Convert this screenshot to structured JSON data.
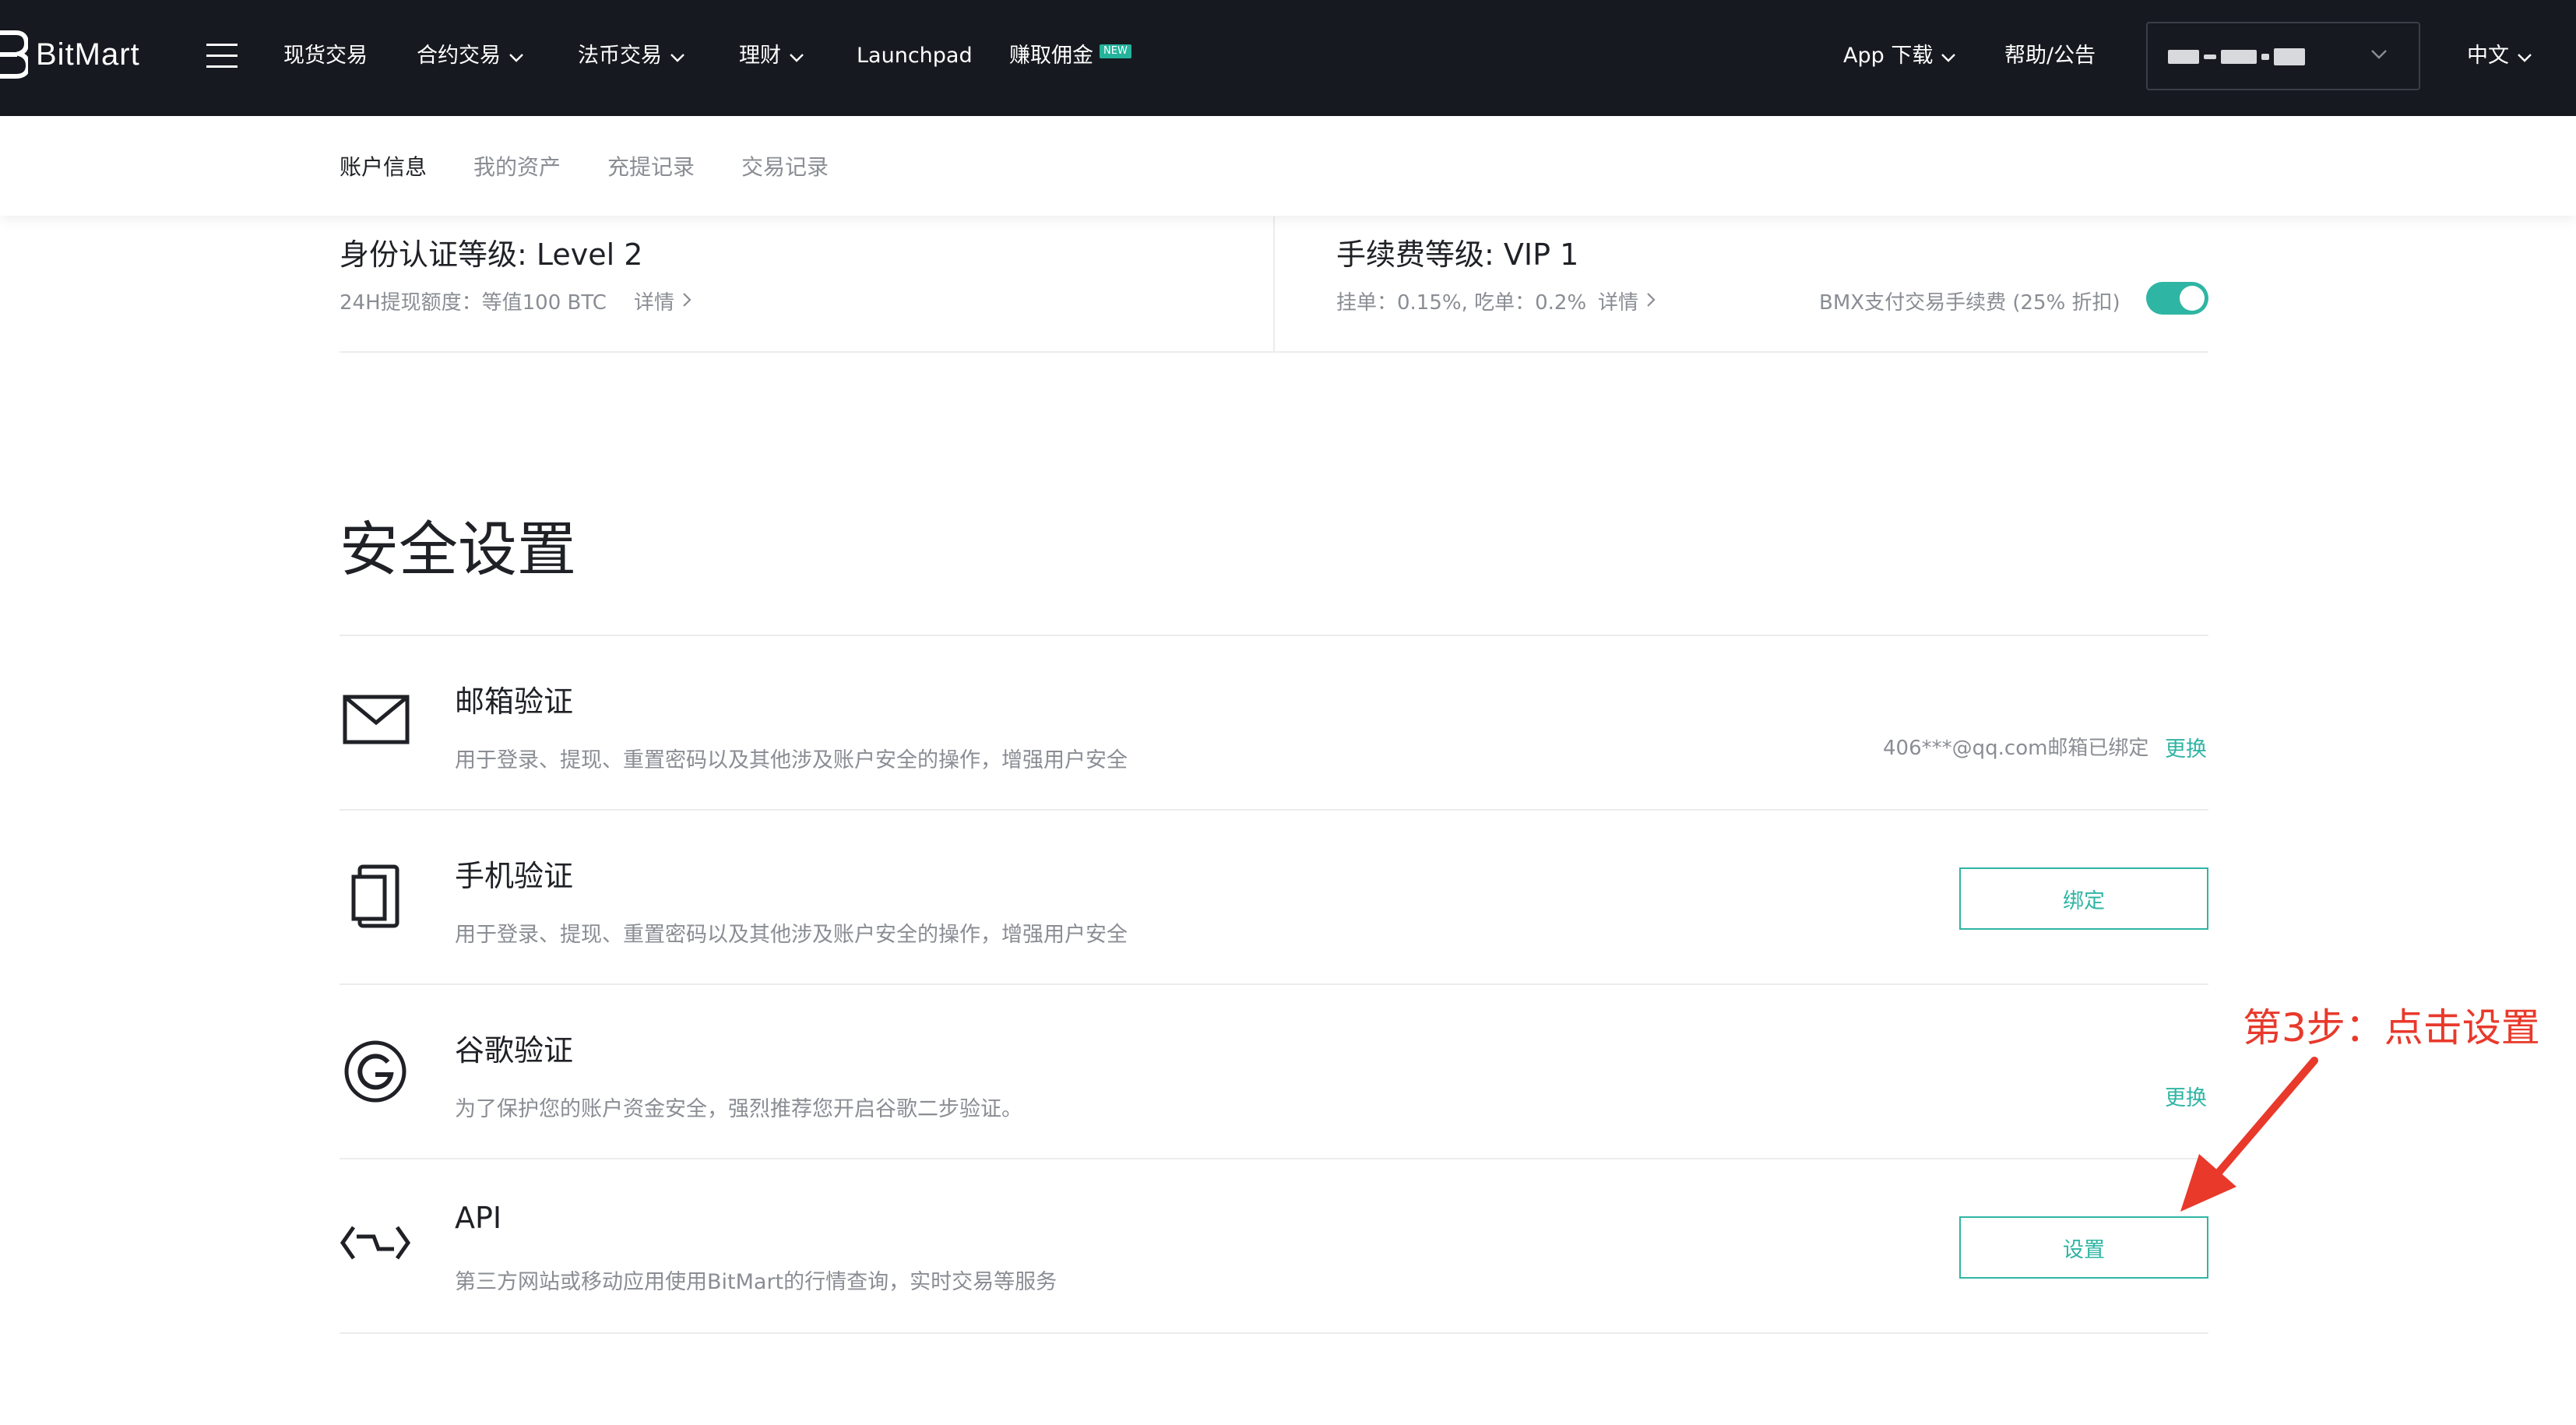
{
  "navbar": {
    "brand": "BitMart",
    "items": [
      {
        "label": "现货交易"
      },
      {
        "label": "合约交易"
      },
      {
        "label": "法币交易"
      },
      {
        "label": "理财"
      },
      {
        "label": "Launchpad"
      },
      {
        "label": "赚取佣金",
        "badge": "NEW"
      }
    ],
    "app_download": "App 下载",
    "help": "帮助/公告",
    "language": "中文"
  },
  "subnav": {
    "tabs": [
      {
        "label": "账户信息",
        "active": true
      },
      {
        "label": "我的资产",
        "active": false
      },
      {
        "label": "充提记录",
        "active": false
      },
      {
        "label": "交易记录",
        "active": false
      }
    ]
  },
  "account_levels": {
    "kyc": {
      "title": "身份认证等级: Level 2",
      "limit": "24H提现额度：等值100 BTC",
      "detail": "详情"
    },
    "fee": {
      "title": "手续费等级: VIP 1",
      "rates": "挂单：0.15%, 吃单：0.2%",
      "detail": "详情",
      "bmx_label": "BMX支付交易手续费 (25% 折扣)",
      "bmx_enabled": true
    }
  },
  "security": {
    "title": "安全设置",
    "rows": [
      {
        "icon": "envelope-icon",
        "title": "邮箱验证",
        "desc": "用于登录、提现、重置密码以及其他涉及账户安全的操作，增强用户安全",
        "status": "406***@qq.com邮箱已绑定",
        "action": "更换"
      },
      {
        "icon": "phone-icon",
        "title": "手机验证",
        "desc": "用于登录、提现、重置密码以及其他涉及账户安全的操作，增强用户安全",
        "action": "绑定"
      },
      {
        "icon": "google-auth-icon",
        "title": "谷歌验证",
        "desc": "为了保护您的账户资金安全，强烈推荐您开启谷歌二步验证。",
        "action": "更换"
      },
      {
        "icon": "api-icon",
        "title": "API",
        "desc": "第三方网站或移动应用使用BitMart的行情查询，实时交易等服务",
        "action": "设置"
      }
    ]
  },
  "annotation": {
    "text": "第3步：点击设置",
    "color": "#e8392b"
  },
  "colors": {
    "accent": "#2fb5a4",
    "navbar_bg": "#16191f",
    "muted_text": "#8a8d93"
  }
}
